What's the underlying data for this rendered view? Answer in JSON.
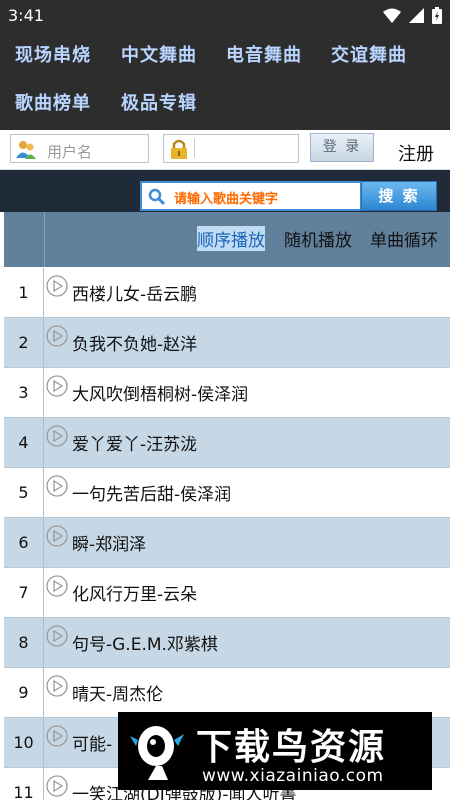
{
  "status": {
    "time": "3:41"
  },
  "nav": {
    "items": [
      {
        "label": "现场串烧"
      },
      {
        "label": "中文舞曲"
      },
      {
        "label": "电音舞曲"
      },
      {
        "label": "交谊舞曲"
      },
      {
        "label": "歌曲榜单"
      },
      {
        "label": "极品专辑"
      }
    ]
  },
  "login": {
    "username_placeholder": "用户名",
    "password_placeholder": "",
    "login_label": "登 录",
    "register_label": "注册"
  },
  "search": {
    "placeholder": "请输入歌曲关键字",
    "button_label": "搜 索"
  },
  "play_modes": [
    {
      "label": "顺序播放",
      "selected": true
    },
    {
      "label": "随机播放",
      "selected": false
    },
    {
      "label": "单曲循环",
      "selected": false
    }
  ],
  "songs": [
    {
      "num": "1",
      "title": "西楼儿女-岳云鹏"
    },
    {
      "num": "2",
      "title": "负我不负她-赵洋"
    },
    {
      "num": "3",
      "title": "大风吹倒梧桐树-侯泽润"
    },
    {
      "num": "4",
      "title": "爱丫爱丫-汪苏泷"
    },
    {
      "num": "5",
      "title": "一句先苦后甜-侯泽润"
    },
    {
      "num": "6",
      "title": "瞬-郑润泽"
    },
    {
      "num": "7",
      "title": "化风行万里-云朵"
    },
    {
      "num": "8",
      "title": "句号-G.E.M.邓紫棋"
    },
    {
      "num": "9",
      "title": "晴天-周杰伦"
    },
    {
      "num": "10",
      "title": "可能-"
    },
    {
      "num": "11",
      "title": "一笑江湖(DJ弹鼓版)-闻人听書_"
    }
  ],
  "watermark": {
    "title": "下载鸟资源",
    "url": "www.xiazainiao.com"
  },
  "colors": {
    "header_bg": "#2d2d2d",
    "nav_text": "#b8d4ff",
    "table_header": "#61809b",
    "row_alt": "#c6d8e6",
    "search_hint": "#ff6a00"
  }
}
